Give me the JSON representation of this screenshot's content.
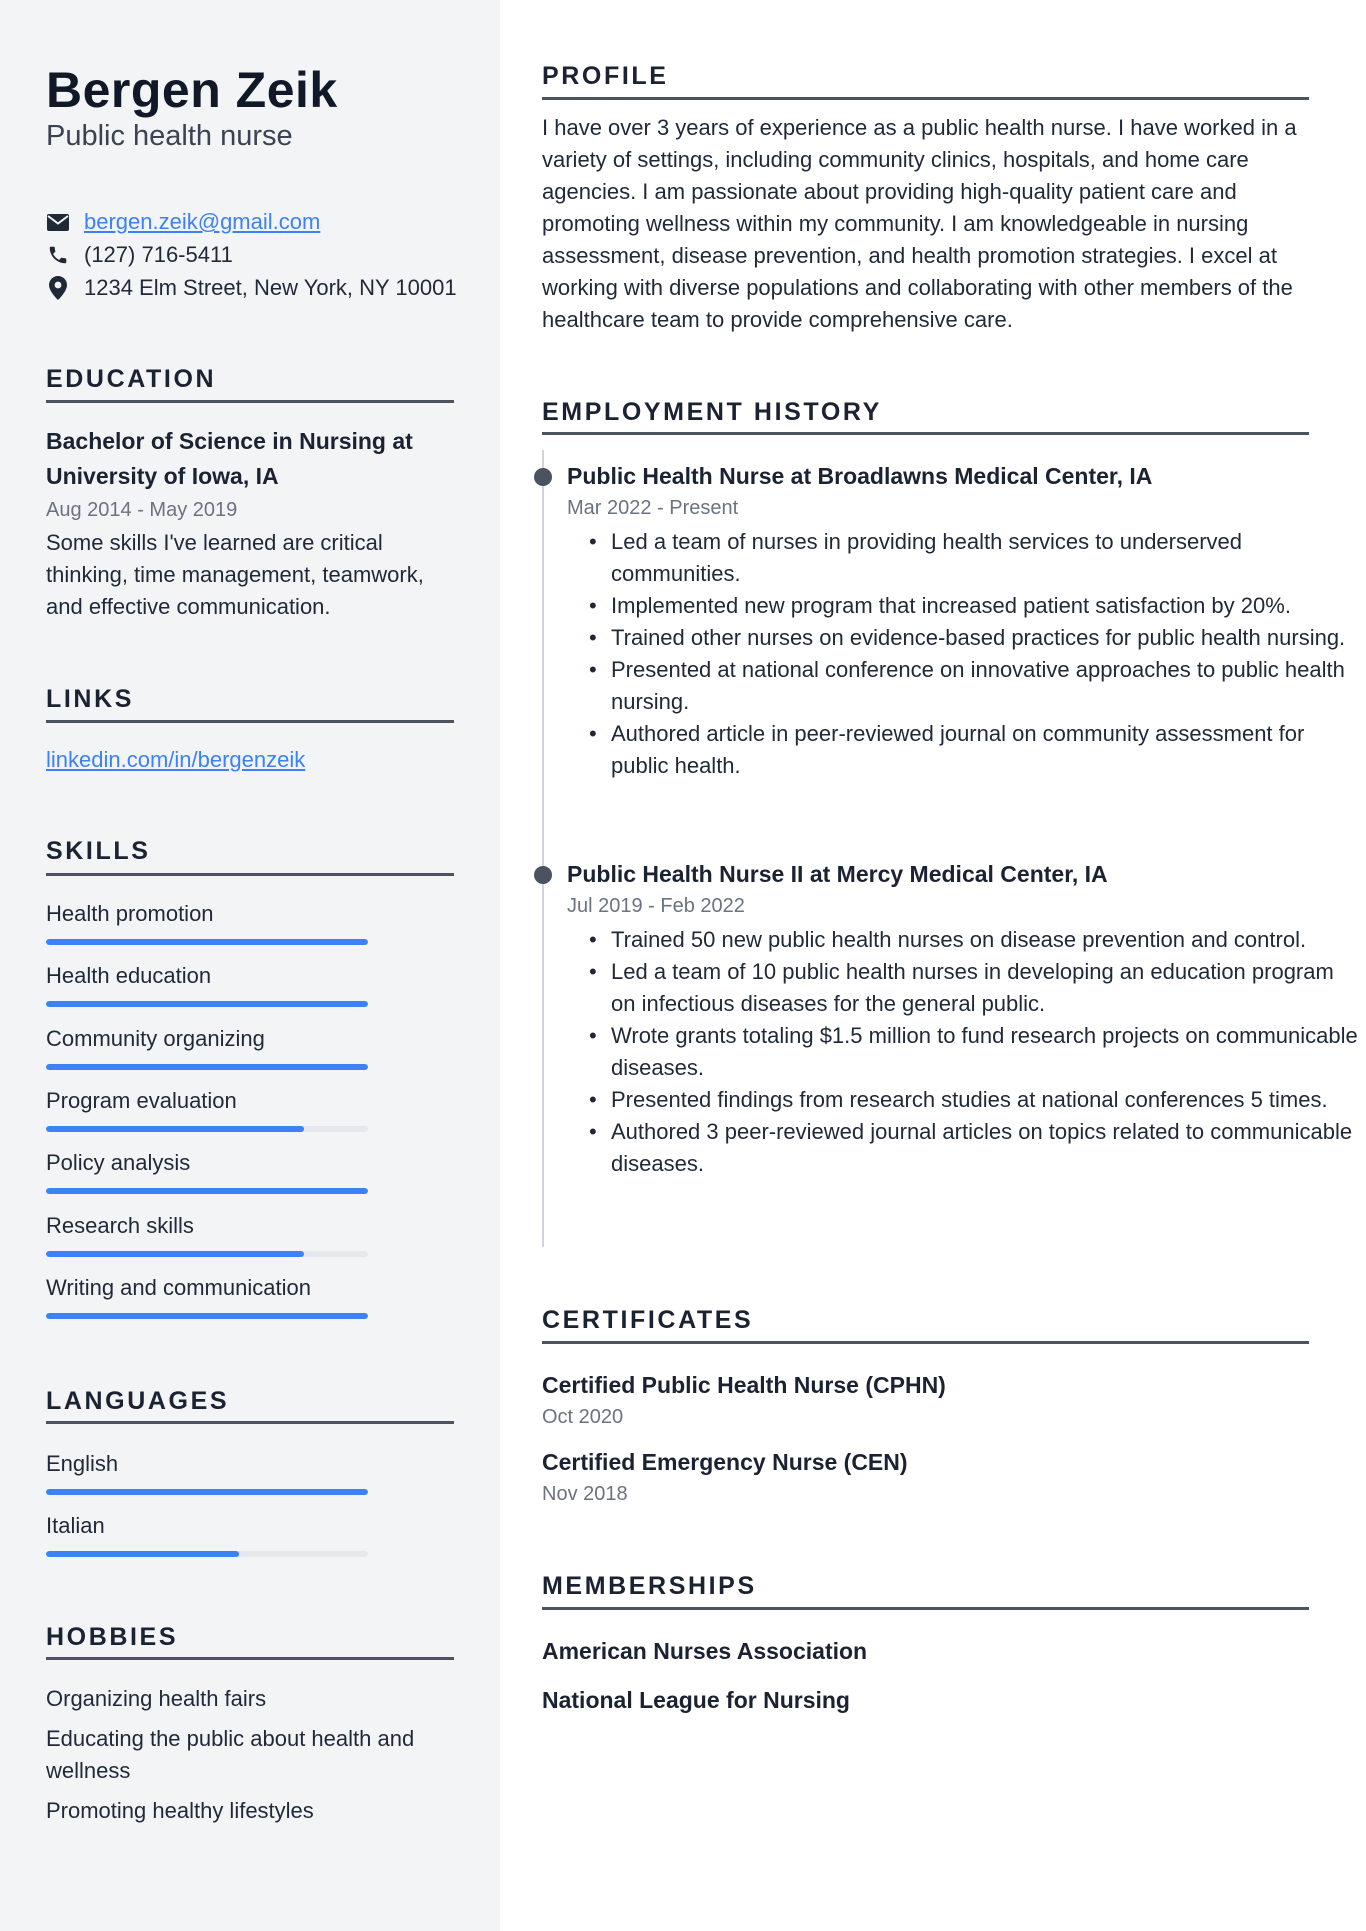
{
  "colors": {
    "accent": "#3b82f6",
    "sidebar_bg": "#f3f4f6",
    "heading": "#1b2232",
    "rule": "#4b5260",
    "muted": "#6b7280"
  },
  "header": {
    "name": "Bergen Zeik",
    "title": "Public health nurse"
  },
  "contact": {
    "email": {
      "icon": "envelope-icon",
      "value": "bergen.zeik@gmail.com"
    },
    "phone": {
      "icon": "phone-icon",
      "value": "(127) 716-5411"
    },
    "address": {
      "icon": "map-pin-icon",
      "value": "1234 Elm Street, New York, NY 10001"
    }
  },
  "education": {
    "heading": "Education",
    "degree": "Bachelor of Science in Nursing at University of Iowa, IA",
    "dates": "Aug 2014 - May 2019",
    "description": "Some skills I've learned are critical thinking, time management, teamwork, and effective communication."
  },
  "links": {
    "heading": "Links",
    "items": [
      "linkedin.com/in/bergenzeik"
    ]
  },
  "skills": {
    "heading": "Skills",
    "items": [
      {
        "label": "Health promotion",
        "level": 1.0
      },
      {
        "label": "Health education",
        "level": 1.0
      },
      {
        "label": "Community organizing",
        "level": 1.0
      },
      {
        "label": "Program evaluation",
        "level": 0.8
      },
      {
        "label": "Policy analysis",
        "level": 1.0
      },
      {
        "label": "Research skills",
        "level": 0.8
      },
      {
        "label": "Writing and communication",
        "level": 1.0
      }
    ]
  },
  "languages": {
    "heading": "Languages",
    "items": [
      {
        "label": "English",
        "level": 1.0
      },
      {
        "label": "Italian",
        "level": 0.6
      }
    ]
  },
  "hobbies": {
    "heading": "Hobbies",
    "items": [
      "Organizing health fairs",
      "Educating the public about health and wellness",
      "Promoting healthy lifestyles"
    ]
  },
  "profile": {
    "heading": "Profile",
    "text": "I have over 3 years of experience as a public health nurse. I have worked in a variety of settings, including community clinics, hospitals, and home care agencies. I am passionate about providing high-quality patient care and promoting wellness within my community. I am knowledgeable in nursing assessment, disease prevention, and health promotion strategies. I excel at working with diverse populations and collaborating with other members of the healthcare team to provide comprehensive care."
  },
  "employment": {
    "heading": "Employment History",
    "jobs": [
      {
        "title": "Public Health Nurse at Broadlawns Medical Center, IA",
        "dates": "Mar 2022 - Present",
        "bullets": [
          "Led a team of nurses in providing health services to underserved communities.",
          "Implemented new program that increased patient satisfaction by 20%.",
          "Trained other nurses on evidence-based practices for public health nursing.",
          "Presented at national conference on innovative approaches to public health nursing.",
          "Authored article in peer-reviewed journal on community assessment for public health."
        ]
      },
      {
        "title": "Public Health Nurse II at Mercy Medical Center, IA",
        "dates": "Jul 2019 - Feb 2022",
        "bullets": [
          "Trained 50 new public health nurses on disease prevention and control.",
          "Led a team of 10 public health nurses in developing an education program on infectious diseases for the general public.",
          "Wrote grants totaling $1.5 million to fund research projects on communicable diseases.",
          "Presented findings from research studies at national conferences 5 times.",
          "Authored 3 peer-reviewed journal articles on topics related to communicable diseases."
        ]
      }
    ]
  },
  "certificates": {
    "heading": "Certificates",
    "items": [
      {
        "title": "Certified Public Health Nurse (CPHN)",
        "date": "Oct 2020"
      },
      {
        "title": "Certified Emergency Nurse (CEN)",
        "date": "Nov 2018"
      }
    ]
  },
  "memberships": {
    "heading": "Memberships",
    "items": [
      "American Nurses Association",
      "National League for Nursing"
    ]
  }
}
